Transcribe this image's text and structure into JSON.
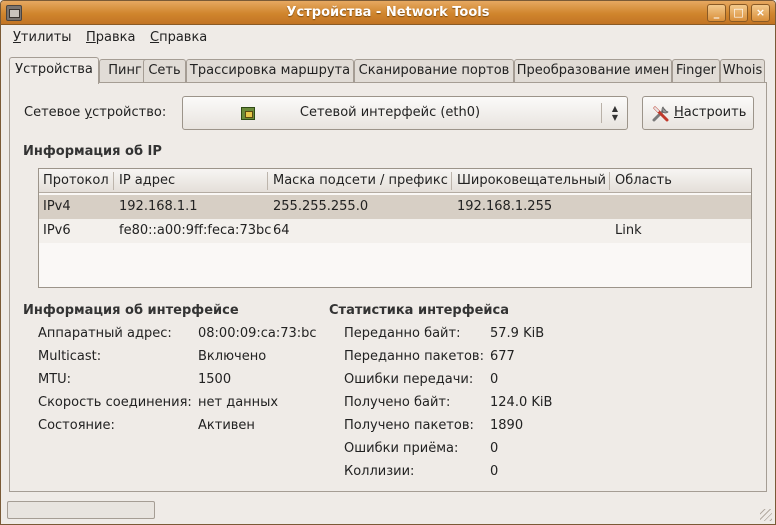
{
  "window": {
    "title": "Устройства - Network Tools"
  },
  "menu": [
    {
      "label": "Утилиты",
      "mn": "У",
      "rest": "тилиты"
    },
    {
      "label": "Правка",
      "mn": "П",
      "rest": "равка"
    },
    {
      "label": "Справка",
      "mn": "С",
      "rest": "правка"
    }
  ],
  "tabs": [
    "Устройства",
    "Пинг",
    "Сеть",
    "Трассировка маршрута",
    "Сканирование портов",
    "Преобразование имен",
    "Finger",
    "Whois"
  ],
  "device": {
    "label_pre": "Сетевое ",
    "label_mn": "у",
    "label_post": "стройство:",
    "selected": "Сетевой интерфейс (eth0)",
    "configure_mn": "Н",
    "configure_rest": "астроить"
  },
  "ip_info": {
    "title": "Информация об IP",
    "columns": [
      "Протокол",
      "IP адрес",
      "Маска подсети / префикс",
      "Широковещательный",
      "Область"
    ],
    "rows": [
      [
        "IPv4",
        "192.168.1.1",
        "255.255.255.0",
        "192.168.1.255",
        ""
      ],
      [
        "IPv6",
        "fe80::a00:9ff:feca:73bc",
        "64",
        "",
        "Link"
      ]
    ]
  },
  "iface_info": {
    "title": "Информация об интерфейсе",
    "items": [
      {
        "label": "Аппаратный адрес:",
        "value": "08:00:09:ca:73:bc"
      },
      {
        "label": "Multicast:",
        "value": "Включено"
      },
      {
        "label": "MTU:",
        "value": "1500"
      },
      {
        "label": "Скорость соединения:",
        "value": "нет данных"
      },
      {
        "label": "Состояние:",
        "value": "Активен"
      }
    ]
  },
  "iface_stats": {
    "title": "Статистика интерфейса",
    "items": [
      {
        "label": "Переданно байт:",
        "value": "57.9 KiB"
      },
      {
        "label": "Переданно пакетов:",
        "value": "677"
      },
      {
        "label": "Ошибки передачи:",
        "value": "0"
      },
      {
        "label": "Получено байт:",
        "value": "124.0 KiB"
      },
      {
        "label": "Получено пакетов:",
        "value": "1890"
      },
      {
        "label": "Ошибки приёма:",
        "value": "0"
      },
      {
        "label": "Коллизии:",
        "value": "0"
      }
    ]
  }
}
